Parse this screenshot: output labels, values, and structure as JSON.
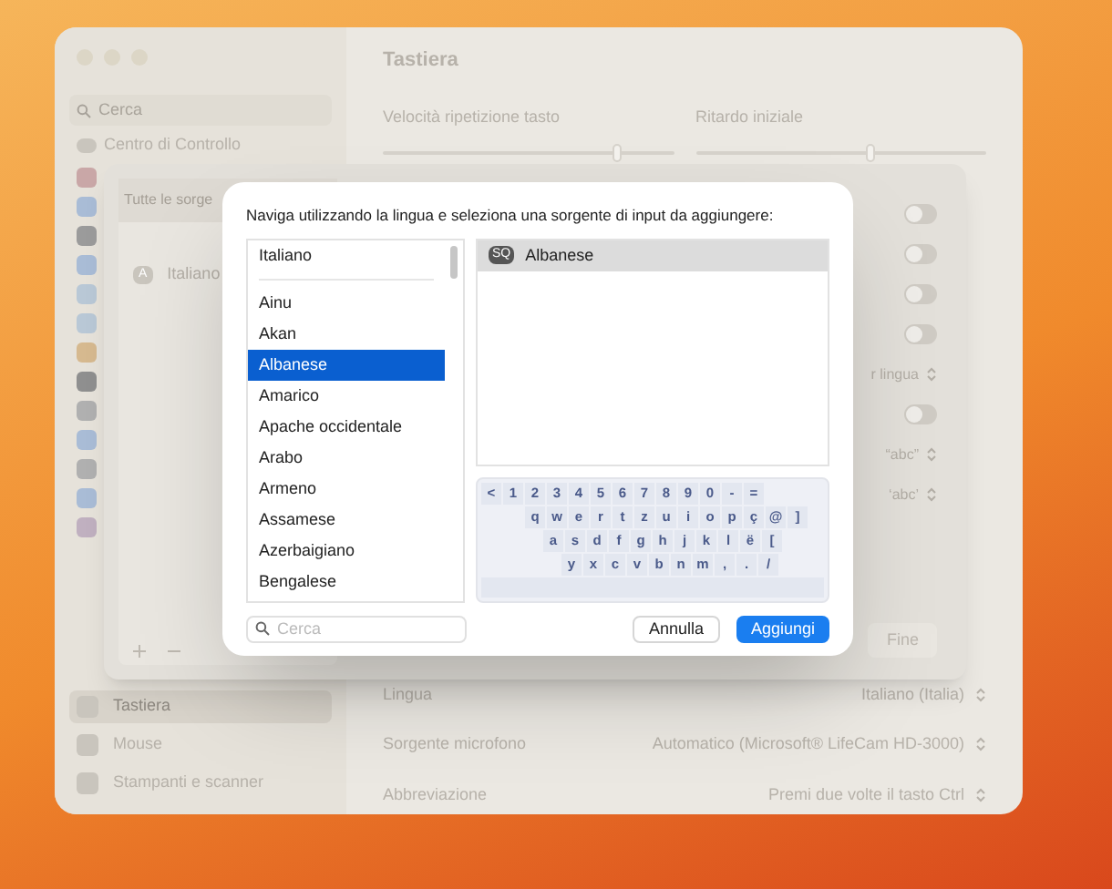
{
  "window": {
    "title": "Tastiera"
  },
  "sidebar": {
    "search_placeholder": "Cerca",
    "items": [
      {
        "label": "Centro di Controllo",
        "selected": false
      },
      {
        "label": "Tastiera",
        "selected": true
      },
      {
        "label": "Mouse",
        "selected": false
      },
      {
        "label": "Stampanti e scanner",
        "selected": false
      }
    ]
  },
  "sliders": [
    {
      "label": "Velocità ripetizione tasto",
      "level": 0.8
    },
    {
      "label": "Ritardo iniziale",
      "level": 0.6
    }
  ],
  "settings_rows": [
    {
      "label": "Lingua",
      "value": "Italiano (Italia)"
    },
    {
      "label": "Sorgente microfono",
      "value": "Automatico (Microsoft® LifeCam HD-3000)"
    },
    {
      "label": "Abbreviazione",
      "value": "Premi due volte il tasto Ctrl"
    }
  ],
  "sources_sheet": {
    "header": "Tutte le sorge",
    "sources": [
      {
        "badge": "A",
        "label": "Italiano"
      }
    ],
    "rows": [
      {
        "kind": "toggle",
        "on": false
      },
      {
        "kind": "toggle",
        "on": false
      },
      {
        "kind": "toggle",
        "on": false
      },
      {
        "kind": "toggle",
        "on": false
      },
      {
        "kind": "popup",
        "value": "r lingua"
      },
      {
        "kind": "toggle",
        "on": false
      },
      {
        "kind": "popup",
        "value": "“abc”"
      },
      {
        "kind": "popup",
        "value": "‘abc’"
      }
    ],
    "done_button": "Fine"
  },
  "dialog": {
    "prompt": "Naviga utilizzando la lingua e seleziona una sorgente di input da aggiungere:",
    "preferred": [
      {
        "label": "Italiano",
        "selected": false
      }
    ],
    "languages": [
      {
        "label": "Ainu",
        "selected": false
      },
      {
        "label": "Akan",
        "selected": false
      },
      {
        "label": "Albanese",
        "selected": true
      },
      {
        "label": "Amarico",
        "selected": false
      },
      {
        "label": "Apache occidentale",
        "selected": false
      },
      {
        "label": "Arabo",
        "selected": false
      },
      {
        "label": "Armeno",
        "selected": false
      },
      {
        "label": "Assamese",
        "selected": false
      },
      {
        "label": "Azerbaigiano",
        "selected": false
      },
      {
        "label": "Bengalese",
        "selected": false
      }
    ],
    "sources": [
      {
        "badge": "SQ",
        "label": "Albanese",
        "selected": true
      }
    ],
    "keyboard_rows": [
      [
        "<",
        "1",
        "2",
        "3",
        "4",
        "5",
        "6",
        "7",
        "8",
        "9",
        "0",
        "-",
        "="
      ],
      [
        "q",
        "w",
        "e",
        "r",
        "t",
        "z",
        "u",
        "i",
        "o",
        "p",
        "ç",
        "@",
        "]"
      ],
      [
        "a",
        "s",
        "d",
        "f",
        "g",
        "h",
        "j",
        "k",
        "l",
        "ë",
        "["
      ],
      [
        "y",
        "x",
        "c",
        "v",
        "b",
        "n",
        "m",
        ",",
        ".",
        "/"
      ]
    ],
    "search_placeholder": "Cerca",
    "buttons": [
      {
        "label": "Annulla",
        "kind": "secondary"
      },
      {
        "label": "Aggiungi",
        "kind": "primary"
      }
    ]
  }
}
